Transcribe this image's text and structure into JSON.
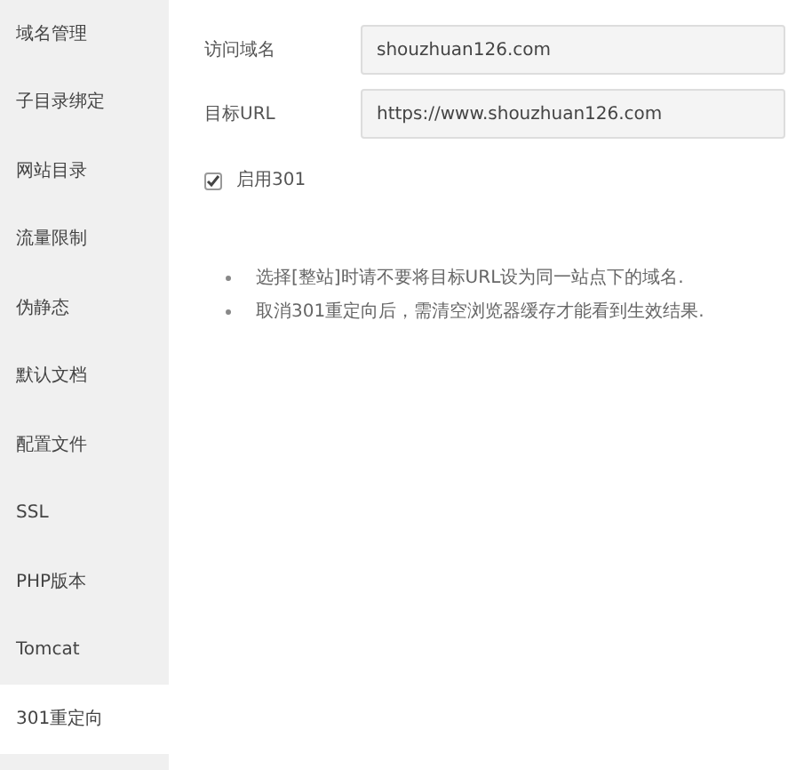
{
  "sidebar": {
    "items": [
      {
        "label": "域名管理",
        "selected": false
      },
      {
        "label": "子目录绑定",
        "selected": false
      },
      {
        "label": "网站目录",
        "selected": false
      },
      {
        "label": "流量限制",
        "selected": false
      },
      {
        "label": "伪静态",
        "selected": false
      },
      {
        "label": "默认文档",
        "selected": false
      },
      {
        "label": "配置文件",
        "selected": false
      },
      {
        "label": "SSL",
        "selected": false
      },
      {
        "label": "PHP版本",
        "selected": false
      },
      {
        "label": "Tomcat",
        "selected": false
      },
      {
        "label": "301重定向",
        "selected": true
      }
    ]
  },
  "form": {
    "fields": [
      {
        "label": "访问域名",
        "value": "shouzhuan126.com"
      },
      {
        "label": "目标URL",
        "value": "https://www.shouzhuan126.com"
      }
    ],
    "enable": {
      "label": "启用301",
      "checked": true
    }
  },
  "notes": [
    "选择[整站]时请不要将目标URL设为同一站点下的域名.",
    "取消301重定向后，需清空浏览器缓存才能看到生效结果."
  ]
}
